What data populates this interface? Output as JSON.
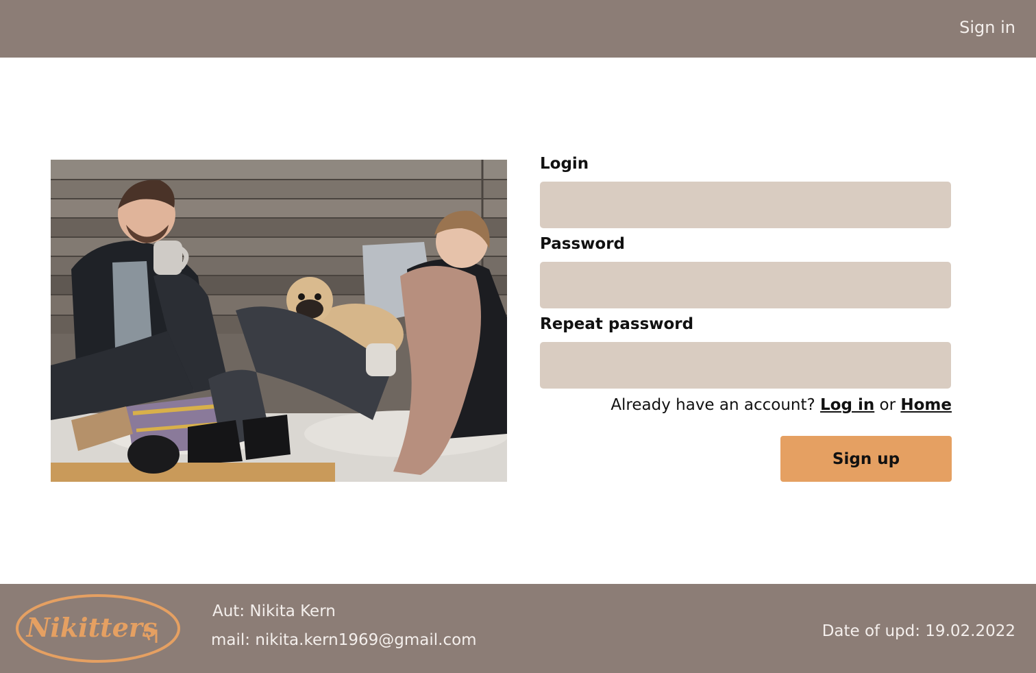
{
  "header": {
    "signin_label": "Sign in"
  },
  "form": {
    "login_label": "Login",
    "login_value": "",
    "password_label": "Password",
    "password_value": "",
    "repeat_label": "Repeat password",
    "repeat_value": "",
    "account_prompt": "Already have an account?",
    "login_link": "Log in",
    "or_text": "or",
    "home_link": "Home",
    "signup_label": "Sign up"
  },
  "footer": {
    "logo_text": "Nikitters",
    "author": "Aut: Nikita Kern",
    "mail": "mail: nikita.kern1969@gmail.com",
    "updated": "Date of upd: 19.02.2022"
  },
  "colors": {
    "header_bg": "#8c7d76",
    "input_bg": "#d9ccc1",
    "accent": "#e5a062",
    "text_light": "#f4efec"
  }
}
